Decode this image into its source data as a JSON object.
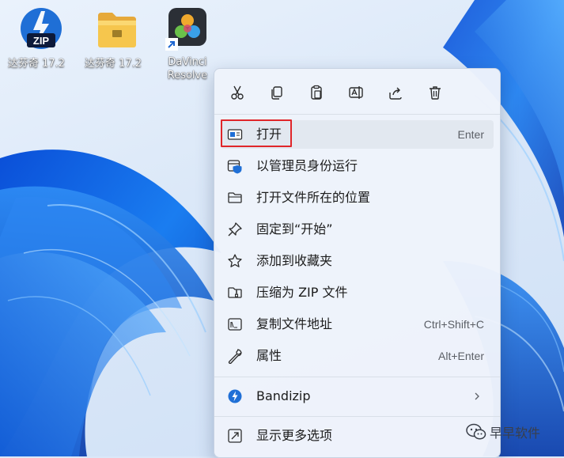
{
  "desktop": {
    "icons": [
      {
        "label": "达芬奇 17.2",
        "icon": "zip-archive-icon"
      },
      {
        "label": "达芬奇 17.2",
        "icon": "folder-icon"
      },
      {
        "label_line1": "DaVinci",
        "label_line2": "Resolve",
        "icon": "davinci-resolve-icon",
        "shortcut": true
      }
    ]
  },
  "context_menu": {
    "toolbar": [
      "cut-icon",
      "copy-icon",
      "paste-icon",
      "rename-icon",
      "share-icon",
      "delete-icon"
    ],
    "items": [
      {
        "label": "打开",
        "shortcut": "Enter",
        "icon": "open-window-icon",
        "selected": true
      },
      {
        "label": "以管理员身份运行",
        "shortcut": "",
        "icon": "admin-shield-icon"
      },
      {
        "label": "打开文件所在的位置",
        "shortcut": "",
        "icon": "folder-open-icon"
      },
      {
        "label": "固定到“开始”",
        "shortcut": "",
        "icon": "pin-icon"
      },
      {
        "label": "添加到收藏夹",
        "shortcut": "",
        "icon": "star-icon"
      },
      {
        "label": "压缩为 ZIP 文件",
        "shortcut": "",
        "icon": "zip-folder-icon"
      },
      {
        "label": "复制文件地址",
        "shortcut": "Ctrl+Shift+C",
        "icon": "copy-path-icon"
      },
      {
        "label": "属性",
        "shortcut": "Alt+Enter",
        "icon": "wrench-icon"
      }
    ],
    "bandizip": {
      "label": "Bandizip",
      "icon": "bandizip-icon",
      "submenu": "chevron-right-icon"
    },
    "more": {
      "label": "显示更多选项",
      "icon": "more-options-icon"
    }
  },
  "watermark": {
    "text": "早早软件",
    "icon": "wechat-icon"
  },
  "colors": {
    "highlight_border": "#e0262a",
    "accent": "#0067c0",
    "menu_bg": "#eef3fb"
  }
}
